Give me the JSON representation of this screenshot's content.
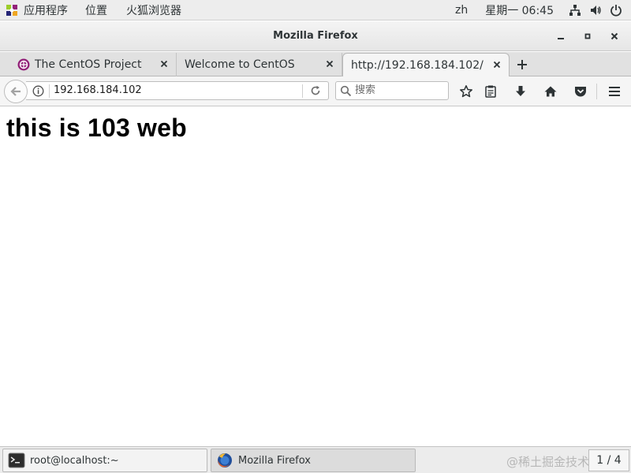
{
  "topbar": {
    "applications_label": "应用程序",
    "places_label": "位置",
    "active_app_label": "火狐浏览器",
    "input_method": "zh",
    "clock": "星期一 06:45",
    "icons": [
      "centos-logo-icon",
      "network-icon",
      "volume-icon",
      "power-icon"
    ]
  },
  "window": {
    "title": "Mozilla Firefox",
    "controls": [
      "minimize-icon",
      "maximize-icon",
      "close-icon"
    ]
  },
  "tabs": [
    {
      "label": "The CentOS Project",
      "active": false,
      "favicon": "centos-favicon-icon"
    },
    {
      "label": "Welcome to CentOS",
      "active": false
    },
    {
      "label": "http://192.168.184.102/",
      "active": true
    }
  ],
  "newtab_label": "+",
  "navbar": {
    "url": "192.168.184.102",
    "search_placeholder": "搜索",
    "icons": [
      "back-arrow-icon",
      "info-icon",
      "reload-icon",
      "search-icon",
      "bookmark-star-icon",
      "reading-list-icon",
      "download-icon",
      "home-icon",
      "pocket-icon",
      "hamburger-menu-icon"
    ]
  },
  "page": {
    "heading": "this is 103 web"
  },
  "taskbar": {
    "items": [
      {
        "label": "root@localhost:~",
        "icon": "terminal-icon",
        "active": false
      },
      {
        "label": "Mozilla Firefox",
        "icon": "firefox-icon",
        "active": true
      }
    ],
    "workspace": "1 / 4",
    "watermark": "@稀土掘金技术社区"
  },
  "colors": {
    "topbar_bg": "#ededed",
    "chrome_bg": "#f5f5f5",
    "tabstrip_bg": "#e1e1e1",
    "page_bg": "#ffffff",
    "text": "#2e3436"
  }
}
